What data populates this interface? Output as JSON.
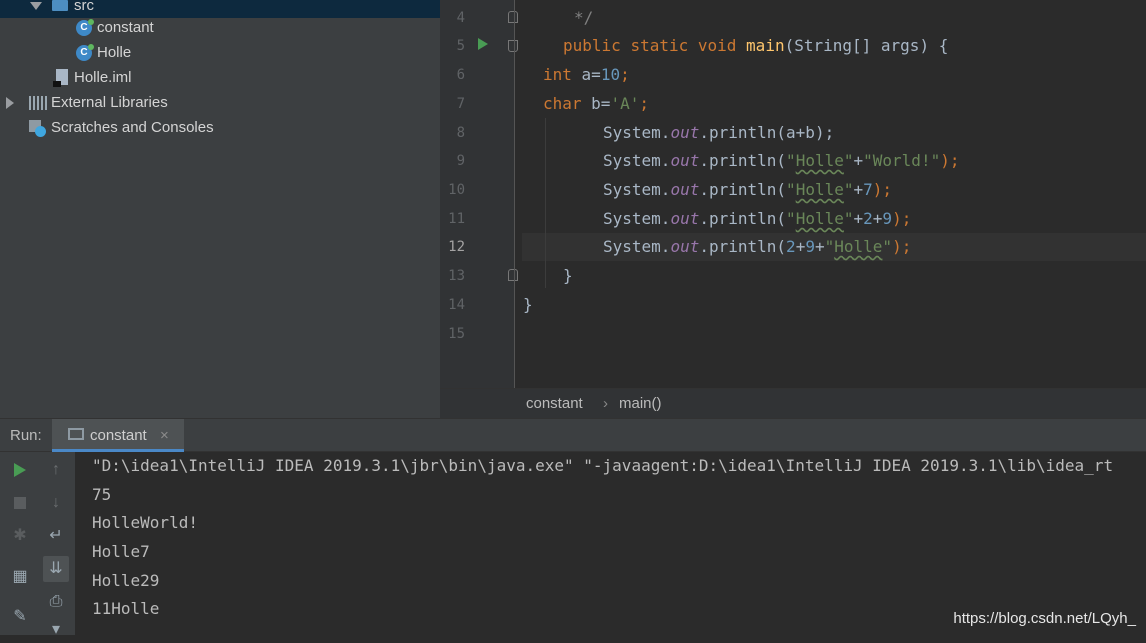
{
  "project_tree": {
    "items": [
      {
        "label": "src",
        "icon": "folder-icon"
      },
      {
        "label": "constant",
        "icon": "class-icon"
      },
      {
        "label": "Holle",
        "icon": "class-icon"
      },
      {
        "label": "Holle.iml",
        "icon": "iml-file-icon"
      },
      {
        "label": "External Libraries",
        "icon": "libraries-icon"
      },
      {
        "label": "Scratches and Consoles",
        "icon": "scratches-icon"
      }
    ]
  },
  "editor": {
    "line_numbers": [
      "4",
      "5",
      "6",
      "7",
      "8",
      "9",
      "10",
      "11",
      "12",
      "13",
      "14",
      "15"
    ],
    "current_line": "12",
    "breadcrumb": {
      "file": "constant",
      "separator": "›",
      "method": "main()"
    },
    "code": {
      "l4": {
        "comment": "*/"
      },
      "l5": {
        "kw1": "public",
        "kw2": "static",
        "kw3": "void",
        "fn": "main",
        "rest": "(String[] args) {"
      },
      "l6": {
        "kw": "int",
        "mid": " a=",
        "num": "10",
        "end": ";"
      },
      "l7": {
        "kw": "char",
        "mid": " b=",
        "str": "'A'",
        "end": ";"
      },
      "l8": {
        "pre": "System.",
        "fld": "out",
        "rest": ".println(a+b);"
      },
      "l9": {
        "pre": "System.",
        "fld": "out",
        "call": ".println(",
        "q1": "\"",
        "s1": "Holle",
        "q2": "\"",
        "plus": "+",
        "s2": "\"World!\"",
        "end": ");"
      },
      "l10": {
        "pre": "System.",
        "fld": "out",
        "call": ".println(",
        "q1": "\"",
        "s1": "Holle",
        "q2": "\"",
        "plus": "+",
        "n1": "7",
        "end": ");"
      },
      "l11": {
        "pre": "System.",
        "fld": "out",
        "call": ".println(",
        "q1": "\"",
        "s1": "Holle",
        "q2": "\"",
        "plus": "+",
        "n1": "2",
        "plus2": "+",
        "n2": "9",
        "end": ");"
      },
      "l12": {
        "pre": "System.",
        "fld": "out",
        "call": ".println(",
        "n1": "2",
        "plus": "+",
        "n2": "9",
        "plus2": "+",
        "q1": "\"",
        "s1": "Holle",
        "q2": "\"",
        "end": ");"
      },
      "l13": {
        "text": "}"
      },
      "l14": {
        "text": "}"
      }
    }
  },
  "run_panel": {
    "label": "Run:",
    "tab_label": "constant",
    "tab_close": "×",
    "console_lines": [
      "\"D:\\idea1\\IntelliJ IDEA 2019.3.1\\jbr\\bin\\java.exe\" \"-javaagent:D:\\idea1\\IntelliJ IDEA 2019.3.1\\lib\\idea_rt",
      "75",
      "HolleWorld!",
      "Holle7",
      "Holle29",
      "11Holle"
    ]
  },
  "watermark": "https://blog.csdn.net/LQyh_",
  "colors": {
    "keyword": "#cc7832",
    "string": "#6a8759",
    "number": "#6897bb",
    "field": "#9876aa",
    "method": "#ffc66d",
    "run_green": "#499c54"
  }
}
